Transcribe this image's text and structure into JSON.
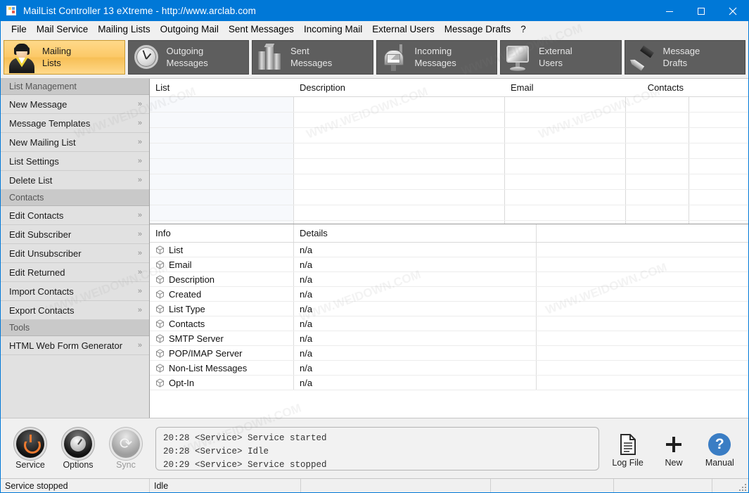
{
  "window": {
    "title": "MailList Controller 13 eXtreme - http://www.arclab.com",
    "icon": "app-icon",
    "minimize": "–",
    "maximize": "□",
    "close": "✕",
    "accent_color": "#0078d7"
  },
  "menubar": {
    "items": [
      {
        "label": "File"
      },
      {
        "label": "Mail Service"
      },
      {
        "label": "Mailing Lists"
      },
      {
        "label": "Outgoing Mail"
      },
      {
        "label": "Sent Messages"
      },
      {
        "label": "Incoming Mail"
      },
      {
        "label": "External Users"
      },
      {
        "label": "Message Drafts"
      },
      {
        "label": "?"
      }
    ]
  },
  "toolbar": {
    "active_index": 0,
    "active_color": "#fcc968",
    "buttons": [
      {
        "line1": "Mailing",
        "line2": "Lists",
        "icon": "person-icon"
      },
      {
        "line1": "Outgoing",
        "line2": "Messages",
        "icon": "clock-icon"
      },
      {
        "line1": "Sent",
        "line2": "Messages",
        "icon": "buildings-icon"
      },
      {
        "line1": "Incoming",
        "line2": "Messages",
        "icon": "mailbox-icon"
      },
      {
        "line1": "External",
        "line2": "Users",
        "icon": "monitor-icon"
      },
      {
        "line1": "Message",
        "line2": "Drafts",
        "icon": "pen-icon"
      }
    ]
  },
  "sidebar": {
    "sections": [
      {
        "header": "List Management",
        "items": [
          {
            "label": "New Message"
          },
          {
            "label": "Message Templates"
          },
          {
            "label": "New Mailing List"
          },
          {
            "label": "List Settings"
          },
          {
            "label": "Delete List"
          }
        ]
      },
      {
        "header": "Contacts",
        "items": [
          {
            "label": "Edit Contacts"
          },
          {
            "label": "Edit Subscriber"
          },
          {
            "label": "Edit Unsubscriber"
          },
          {
            "label": "Edit Returned"
          },
          {
            "label": "Import Contacts"
          },
          {
            "label": "Export Contacts"
          }
        ]
      },
      {
        "header": "Tools",
        "items": [
          {
            "label": "HTML Web Form Generator"
          }
        ]
      }
    ],
    "chevron": "»"
  },
  "lists_grid": {
    "columns": [
      {
        "label": "List"
      },
      {
        "label": "Description"
      },
      {
        "label": "Email"
      },
      {
        "label": "Contacts"
      },
      {
        "label": ""
      }
    ],
    "rows": []
  },
  "info_grid": {
    "columns": [
      {
        "label": "Info"
      },
      {
        "label": "Details"
      },
      {
        "label": ""
      }
    ],
    "rows": [
      {
        "info": "List",
        "details": "n/a"
      },
      {
        "info": "Email",
        "details": "n/a"
      },
      {
        "info": "Description",
        "details": "n/a"
      },
      {
        "info": "Created",
        "details": "n/a"
      },
      {
        "info": "List Type",
        "details": "n/a"
      },
      {
        "info": "Contacts",
        "details": "n/a"
      },
      {
        "info": "SMTP Server",
        "details": "n/a"
      },
      {
        "info": "POP/IMAP Server",
        "details": "n/a"
      },
      {
        "info": "Non-List Messages",
        "details": "n/a"
      },
      {
        "info": "Opt-In",
        "details": "n/a"
      }
    ]
  },
  "bottom_bar": {
    "left_buttons": [
      {
        "label": "Service",
        "icon": "power-icon",
        "enabled": true
      },
      {
        "label": "Options",
        "icon": "dial-icon",
        "enabled": true
      },
      {
        "label": "Sync",
        "icon": "sync-icon",
        "enabled": false
      }
    ],
    "right_buttons": [
      {
        "label": "Log File",
        "icon": "document-icon"
      },
      {
        "label": "New",
        "icon": "plus-icon"
      },
      {
        "label": "Manual",
        "icon": "help-icon"
      }
    ],
    "log_lines": [
      "20:28 <Service> Service started",
      "20:28 <Service> Idle",
      "20:29 <Service> Service stopped"
    ]
  },
  "statusbar": {
    "cells": [
      "Service stopped",
      "Idle",
      "",
      "",
      "",
      ""
    ]
  },
  "watermarks": [
    "WWW.WEIDOWN.COM",
    "WWW.WEIDOWN.COM",
    "WWW.WEIDOWN.COM",
    "WWW.WEIDOWN.COM",
    "WWW.WEIDOWN.COM",
    "WWW.WEIDOWN.COM",
    "WWW.WEIDOWN.COM",
    "WWW.WEIDOWN.COM"
  ]
}
